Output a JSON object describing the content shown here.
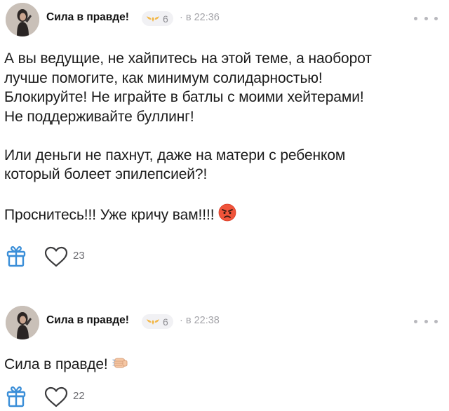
{
  "comments": [
    {
      "author": "Сила в правде!",
      "badge_count": "6",
      "time": "· в 22:36",
      "paragraphs": [
        [
          "А вы ведущие, не хайпитесь на этой теме, а наоборот",
          "лучше помогите, как минимум солидарностью!",
          "Блокируйте! Не играйте в батлы с моими хейтерами!",
          "Не поддерживайте буллинг!"
        ],
        [
          "Или деньги не пахнут, даже на матери с ребенком",
          "который болеет эпилепсией?!"
        ],
        [
          "Проснитесь!!! Уже кричу вам!!!!"
        ]
      ],
      "trailing_emoji": "angry-face-icon",
      "likes": "23"
    },
    {
      "author": "Сила в правде!",
      "badge_count": "6",
      "time": "· в 22:38",
      "paragraphs": [
        [
          "Сила в правде!"
        ]
      ],
      "trailing_emoji": "fist-icon",
      "likes": "22"
    }
  ],
  "colors": {
    "badge_icon": "#f2b84b",
    "icon_stroke": "#3a8ed8",
    "meta_text": "#a3a3a8"
  }
}
